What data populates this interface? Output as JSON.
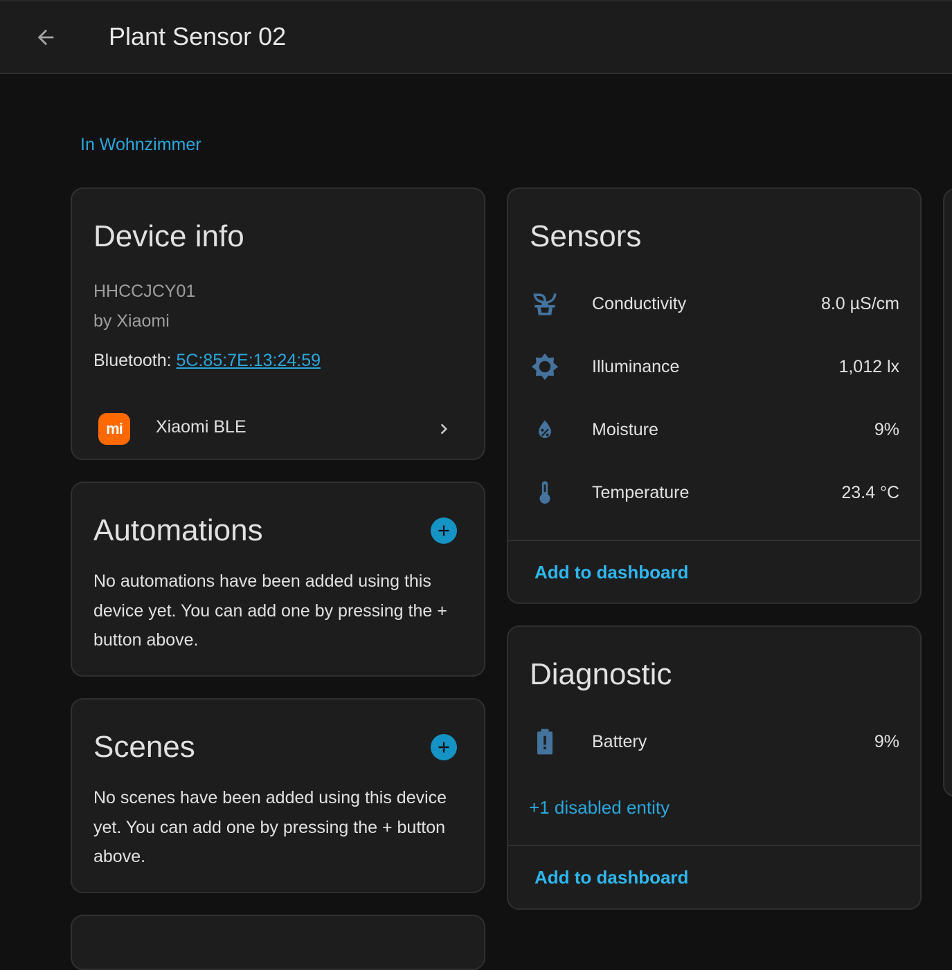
{
  "header": {
    "title": "Plant Sensor 02"
  },
  "area_link": "In Wohnzimmer",
  "device_info": {
    "title": "Device info",
    "model": "HHCCJCY01",
    "manufacturer": "by Xiaomi",
    "connection_label": "Bluetooth: ",
    "connection_value": "5C:85:7E:13:24:59",
    "integration": "Xiaomi BLE",
    "integration_logo_text": "mi"
  },
  "automations": {
    "title": "Automations",
    "empty_text": "No automations have been added using this device yet. You can add one by pressing the + button above."
  },
  "scenes": {
    "title": "Scenes",
    "empty_text": "No scenes have been added using this device yet. You can add one by pressing the + button above."
  },
  "sensors": {
    "title": "Sensors",
    "items": [
      {
        "name": "Conductivity",
        "value": "8.0 µS/cm",
        "icon": "sprout-icon"
      },
      {
        "name": "Illuminance",
        "value": "1,012 lx",
        "icon": "brightness-icon"
      },
      {
        "name": "Moisture",
        "value": "9%",
        "icon": "water-percent-icon"
      },
      {
        "name": "Temperature",
        "value": "23.4 °C",
        "icon": "thermometer-icon"
      }
    ],
    "add_label": "Add to dashboard"
  },
  "diagnostic": {
    "title": "Diagnostic",
    "items": [
      {
        "name": "Battery",
        "value": "9%",
        "icon": "battery-alert-icon"
      }
    ],
    "disabled_link": "+1 disabled entity",
    "add_label": "Add to dashboard"
  },
  "colors": {
    "accent": "#2fb6ee",
    "icon_blue": "#44739e",
    "add_button": "#1593c4",
    "xiaomi_orange": "#ff6900"
  }
}
